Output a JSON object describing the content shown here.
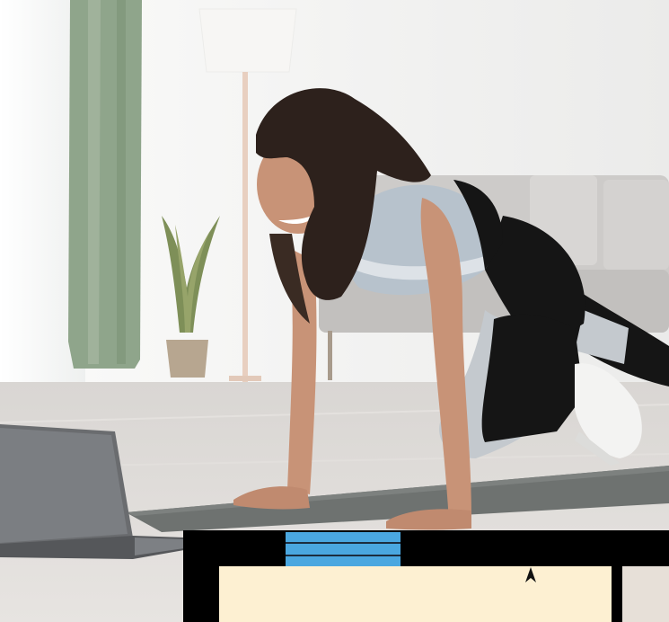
{
  "scene": {
    "objects": [
      "window",
      "curtain",
      "floor-lamp",
      "potted-plant",
      "sofa",
      "person-exercising",
      "exercise-mat",
      "laptop"
    ],
    "colors": {
      "wall": "#f2f2f1",
      "floor": "#dcd9d6",
      "curtain": "#8fa58b",
      "sofa": "#c9c7c5",
      "mat": "#6e7270",
      "top": "#b7c2cc",
      "leggings": "#151515",
      "leggings_accent": "#c4c9ce",
      "hair": "#2d211c",
      "skin": "#c89377"
    }
  },
  "overlay": {
    "colors": {
      "bar": "#000000",
      "tab": "#4aa7e0",
      "panel": "#fdf0d2",
      "side": "#e7e0d8"
    }
  }
}
